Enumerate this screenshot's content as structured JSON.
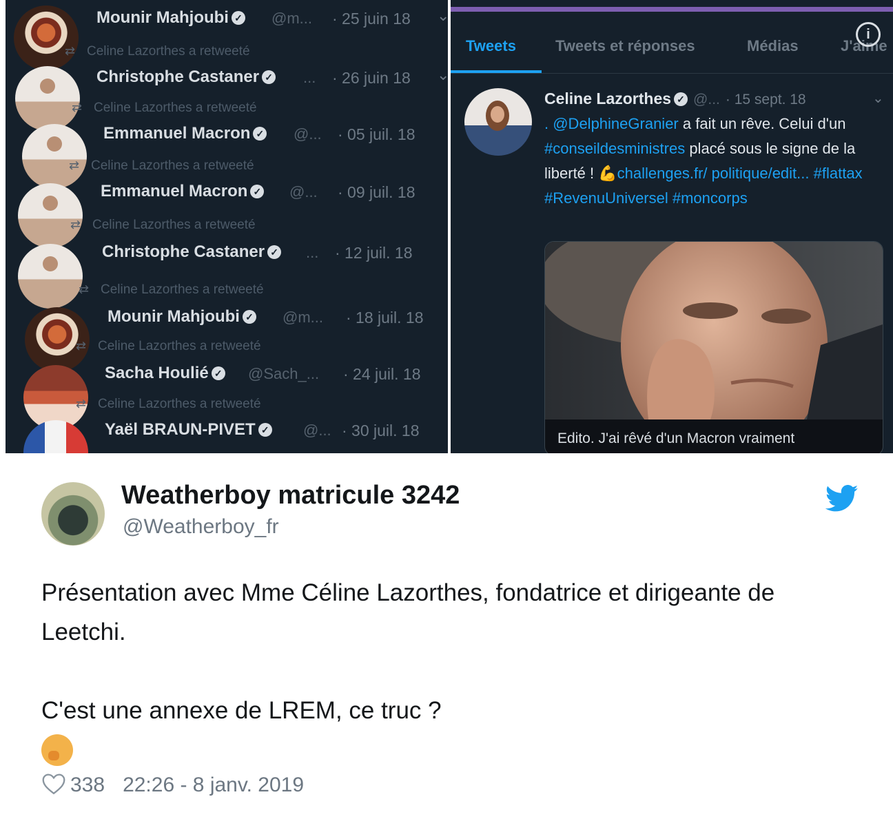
{
  "feed": {
    "retweet_label": "Celine Lazorthes a retweeté",
    "retweet_icon": "retweet-icon",
    "items": [
      {
        "name": "Mounir Mahjoubi",
        "handle": "@m...",
        "date": "· 25 juin 18"
      },
      {
        "name": "Christophe Castaner",
        "handle": "...",
        "date": "· 26 juin 18"
      },
      {
        "name": "Emmanuel Macron",
        "handle": "@...",
        "date": "· 05 juil. 18"
      },
      {
        "name": "Emmanuel Macron",
        "handle": "@...",
        "date": "· 09 juil. 18"
      },
      {
        "name": "Christophe Castaner",
        "handle": "...",
        "date": "· 12 juil. 18"
      },
      {
        "name": "Mounir Mahjoubi",
        "handle": "@m...",
        "date": "· 18 juil. 18"
      },
      {
        "name": "Sacha Houlié",
        "handle": "@Sach_...",
        "date": "· 24 juil. 18"
      },
      {
        "name": "Yaël BRAUN-PIVET",
        "handle": "@...",
        "date": "· 30 juil. 18"
      }
    ]
  },
  "profile": {
    "tabs": [
      "Tweets",
      "Tweets et réponses",
      "Médias",
      "J'aime"
    ],
    "active_tab": "Tweets",
    "info_icon": "info-icon",
    "tweet": {
      "name": "Celine Lazorthes",
      "handle": "@...",
      "date": "· 15 sept. 18",
      "mention": ". @DelphineGranier",
      "text_1": " a fait un rêve. Celui d'un ",
      "hashtag_1": "#conseildesministres",
      "text_2": " placé sous le signe de la liberté ! ",
      "emoji": "💪",
      "link": "challenges.fr/ politique/edit...",
      "hashtag_2": " #flattax",
      "hashtag_3": "#RevenuUniversel #moncorps",
      "card_title": "Edito. J'ai rêvé d'un Macron vraiment"
    },
    "accent_color": "#1da1f2"
  },
  "bottom_tweet": {
    "name": "Weatherboy matricule 3242",
    "handle": "@Weatherboy_fr",
    "paragraph_1": "Présentation avec Mme Céline Lazorthes, fondatrice et dirigeante de Leetchi.",
    "paragraph_2": "C'est une annexe de LREM, ce truc ?",
    "emoji_icon": "thinking-face-icon",
    "likes": "338",
    "timestamp": "22:26 - 8 janv. 2019",
    "bird_color": "#1da1f2"
  }
}
